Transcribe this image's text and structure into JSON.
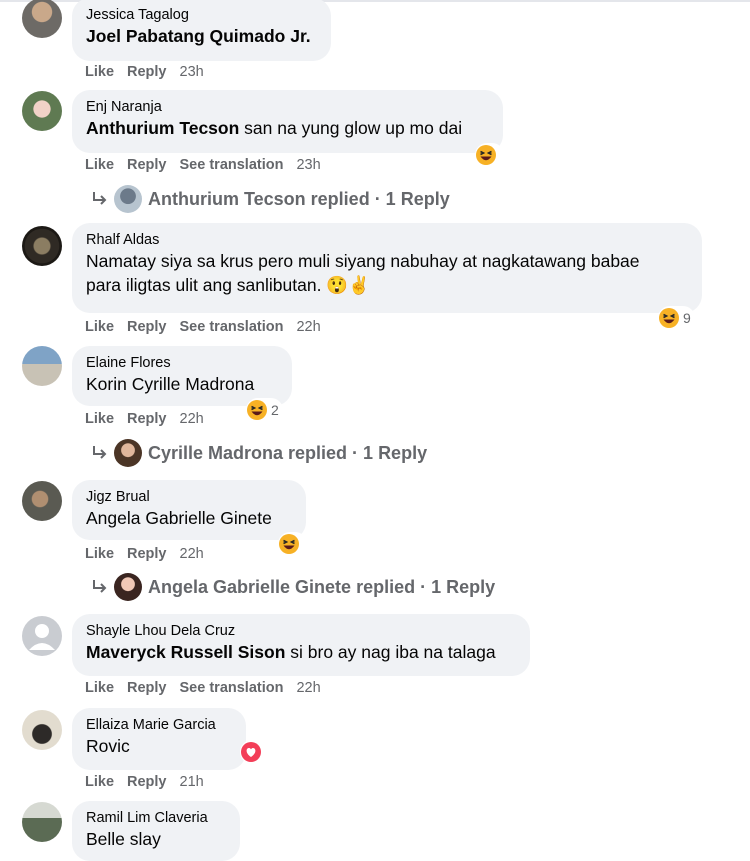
{
  "comments": [
    {
      "author": "Jessica Tagalog",
      "tag": "Joel Pabatang Quimado Jr.",
      "text": "",
      "actions": {
        "like": "Like",
        "reply": "Reply",
        "time": "23h"
      }
    },
    {
      "author": "Enj Naranja",
      "tag": "Anthurium Tecson",
      "text": " san na yung glow up mo dai",
      "actions": {
        "like": "Like",
        "reply": "Reply",
        "translate": "See translation",
        "time": "23h"
      },
      "reaction": {
        "count": ""
      },
      "reply_summary": {
        "text": "Anthurium Tecson replied · 1 Reply"
      }
    },
    {
      "author": "Rhalf Aldas",
      "text1": "Namatay siya sa krus pero muli siyang nabuhay at nagkatawang babae",
      "text2": "para iligtas ulit ang sanlibutan. 😲✌",
      "actions": {
        "like": "Like",
        "reply": "Reply",
        "translate": "See translation",
        "time": "22h"
      },
      "reaction": {
        "count": "9"
      }
    },
    {
      "author": "Elaine Flores",
      "tag": "Korin Cyrille Madrona",
      "actions": {
        "like": "Like",
        "reply": "Reply",
        "time": "22h"
      },
      "reaction": {
        "count": "2"
      },
      "reply_summary": {
        "text": "Cyrille Madrona replied · 1 Reply"
      }
    },
    {
      "author": "Jigz Brual",
      "tag": "Angela Gabrielle Ginete",
      "actions": {
        "like": "Like",
        "reply": "Reply",
        "time": "22h"
      },
      "reaction": {
        "count": ""
      },
      "reply_summary": {
        "text": "Angela Gabrielle Ginete replied · 1 Reply"
      }
    },
    {
      "author": "Shayle Lhou Dela Cruz",
      "tag": "Maveryck Russell Sison",
      "text": " si bro ay nag iba na talaga",
      "actions": {
        "like": "Like",
        "reply": "Reply",
        "translate": "See translation",
        "time": "22h"
      }
    },
    {
      "author": "Ellaiza Marie Garcia",
      "tag": "Rovic",
      "actions": {
        "like": "Like",
        "reply": "Reply",
        "time": "21h"
      },
      "reaction": {
        "count": ""
      }
    },
    {
      "author": "Ramil Lim Claveria",
      "tag": "Belle",
      "text": " slay"
    }
  ],
  "colors": {
    "bubble": "#f0f2f5",
    "meta": "#65676b",
    "haha": "#f7b125",
    "love": "#f33e58"
  }
}
